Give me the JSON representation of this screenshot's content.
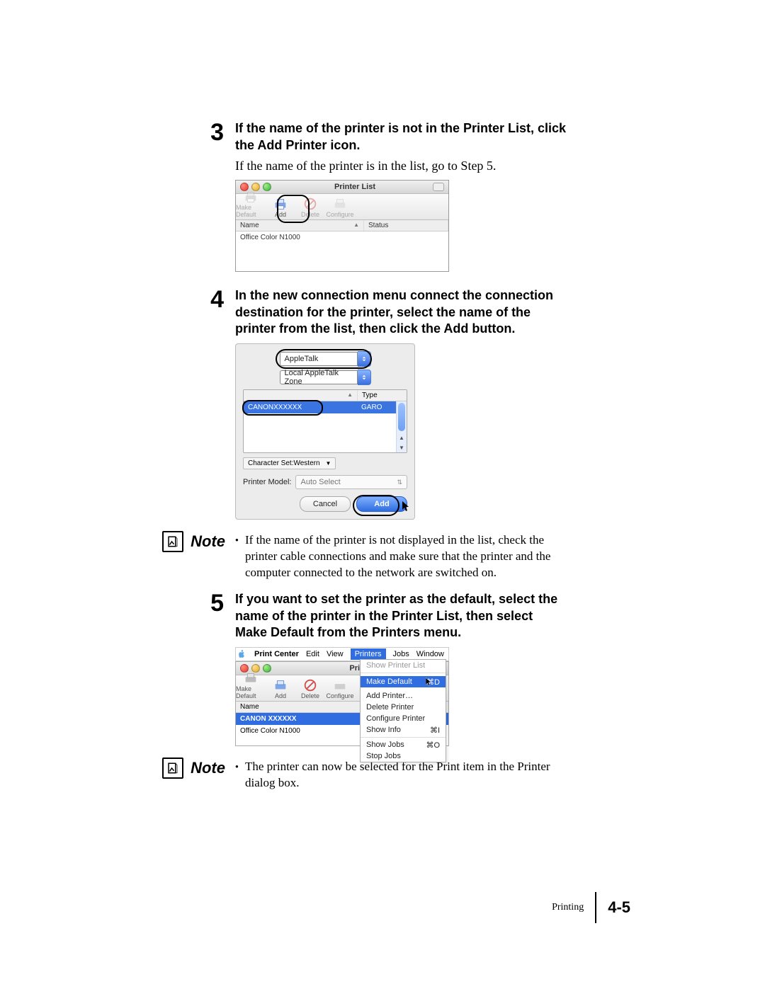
{
  "steps": {
    "s3": {
      "num": "3",
      "text_bold": "If the name of the printer is not in the Printer List, click the Add Printer icon.",
      "text_serif": "If the name of the printer is in the list, go to Step 5."
    },
    "s4": {
      "num": "4",
      "text_bold": "In the new connection menu connect the connection destination for the printer, select the name of the printer from the list, then click the Add button."
    },
    "s5": {
      "num": "5",
      "text_bold": "If you want to set the printer as the default, select the name of the printer in the Printer List, then select Make Default from the Printers menu."
    }
  },
  "notes": {
    "label": "Note",
    "n1": "If the name of the printer is not displayed in the list, check the printer cable connections and make sure that the printer and the computer connected to the network are switched on.",
    "n2": "The printer can now be selected for the Print item in the Printer dialog box."
  },
  "fig1": {
    "title": "Printer List",
    "toolbar": {
      "make_default": "Make Default",
      "add": "Add",
      "delete": "Delete",
      "configure": "Configure"
    },
    "columns": {
      "name": "Name",
      "status": "Status"
    },
    "row0": "Office Color N1000"
  },
  "fig2": {
    "conn_select": "AppleTalk",
    "zone_select": "Local AppleTalk Zone",
    "columns": {
      "type": "Type"
    },
    "row0_name": "CANONXXXXXX",
    "row0_type": "GARO",
    "charset_label": "Character Set:Western",
    "pm_label": "Printer Model:",
    "pm_value": "Auto Select",
    "cancel": "Cancel",
    "add": "Add"
  },
  "fig3": {
    "menubar": {
      "app": "Print Center",
      "edit": "Edit",
      "view": "View",
      "printers": "Printers",
      "jobs": "Jobs",
      "window": "Window"
    },
    "title_short": "Printe",
    "title_full_placeholder": "Printer List",
    "toolbar": {
      "make_default": "Make Default",
      "add": "Add",
      "delete": "Delete",
      "configure": "Configure"
    },
    "namecol": "Name",
    "rows": {
      "r0": "CANON XXXXXX",
      "r1": "Office Color N1000"
    },
    "menu": {
      "show_list": "Show Printer List",
      "make_default": "Make Default",
      "make_default_sc": "⌘D",
      "add_printer": "Add Printer…",
      "delete_printer": "Delete Printer",
      "configure_printer": "Configure Printer",
      "show_info": "Show Info",
      "show_info_sc": "⌘I",
      "show_jobs": "Show Jobs",
      "show_jobs_sc": "⌘O",
      "stop_jobs": "Stop Jobs"
    }
  },
  "footer": {
    "section": "Printing",
    "page": "4-5"
  }
}
